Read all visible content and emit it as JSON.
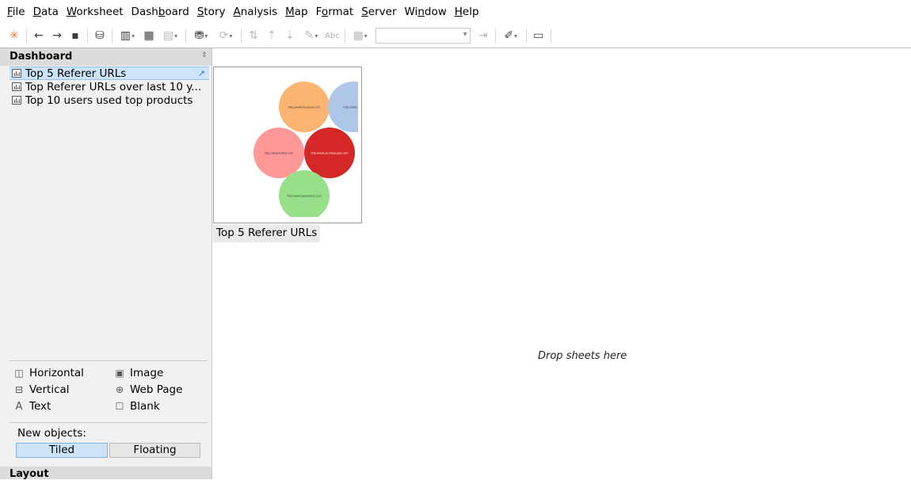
{
  "menu": [
    {
      "label": "File",
      "mn": "F",
      "rest": "ile"
    },
    {
      "label": "Data",
      "mn": "D",
      "rest": "ata"
    },
    {
      "label": "Worksheet",
      "mn": "W",
      "rest": "orksheet"
    },
    {
      "label": "Dashboard",
      "pre": "Dash",
      "mn": "b",
      "rest": "oard"
    },
    {
      "label": "Story",
      "mn": "S",
      "rest": "tory"
    },
    {
      "label": "Analysis",
      "mn": "A",
      "rest": "nalysis"
    },
    {
      "label": "Map",
      "mn": "M",
      "rest": "ap"
    },
    {
      "label": "Format",
      "pre": "F",
      "mn": "o",
      "rest": "rmat"
    },
    {
      "label": "Server",
      "mn": "S",
      "rest": "erver"
    },
    {
      "label": "Window",
      "pre": "Wi",
      "mn": "n",
      "rest": "dow"
    },
    {
      "label": "Help",
      "mn": "H",
      "rest": "elp"
    }
  ],
  "toolbar": {
    "abc_label": "Abc",
    "combo_value": "",
    "icons": [
      "tableau-logo-icon",
      "undo-icon",
      "redo-icon",
      "save-icon",
      "new-data-source-icon",
      "new-worksheet-icon",
      "duplicate-icon",
      "clear-icon",
      "pause-updates-icon",
      "refresh-icon",
      "swap-icon",
      "sort-ascending-icon",
      "sort-descending-icon",
      "highlight-icon",
      "labels-icon",
      "fit-icon",
      "fix-axes-icon",
      "pen-icon",
      "presentation-icon"
    ]
  },
  "left_panel": {
    "header": "Dashboard",
    "sheets": [
      {
        "label": "Top 5 Referer URLs",
        "selected": true
      },
      {
        "label": "Top Referer URLs over last 10 y...",
        "selected": false
      },
      {
        "label": "Top 10 users used top products",
        "selected": false
      }
    ],
    "objects": {
      "horizontal": "Horizontal",
      "image": "Image",
      "vertical": "Vertical",
      "web_page": "Web Page",
      "text": "Text",
      "blank": "Blank"
    },
    "new_objects_label": "New objects:",
    "tiled_label": "Tiled",
    "floating_label": "Floating",
    "layout_label": "Layout"
  },
  "canvas": {
    "thumbnail_caption": "Top 5 Referer URLs",
    "drop_hint": "Drop sheets here",
    "bubbles": [
      {
        "label": "http://www.facebook.com",
        "color": "#fcb571"
      },
      {
        "label": "http://www.yo...",
        "color": "#aec7e8"
      },
      {
        "label": "http://www.twitter.com",
        "color": "#ff9896"
      },
      {
        "label": "http://www.stumbleupon.com",
        "color": "#d62728"
      },
      {
        "label": "http://www.bestsellers.com",
        "color": "#98df8a"
      }
    ]
  },
  "colors": {
    "selection_bg": "#cde3f8",
    "panel_bg": "#f1f1f1",
    "panel_header_bg": "#dcdcdc"
  }
}
